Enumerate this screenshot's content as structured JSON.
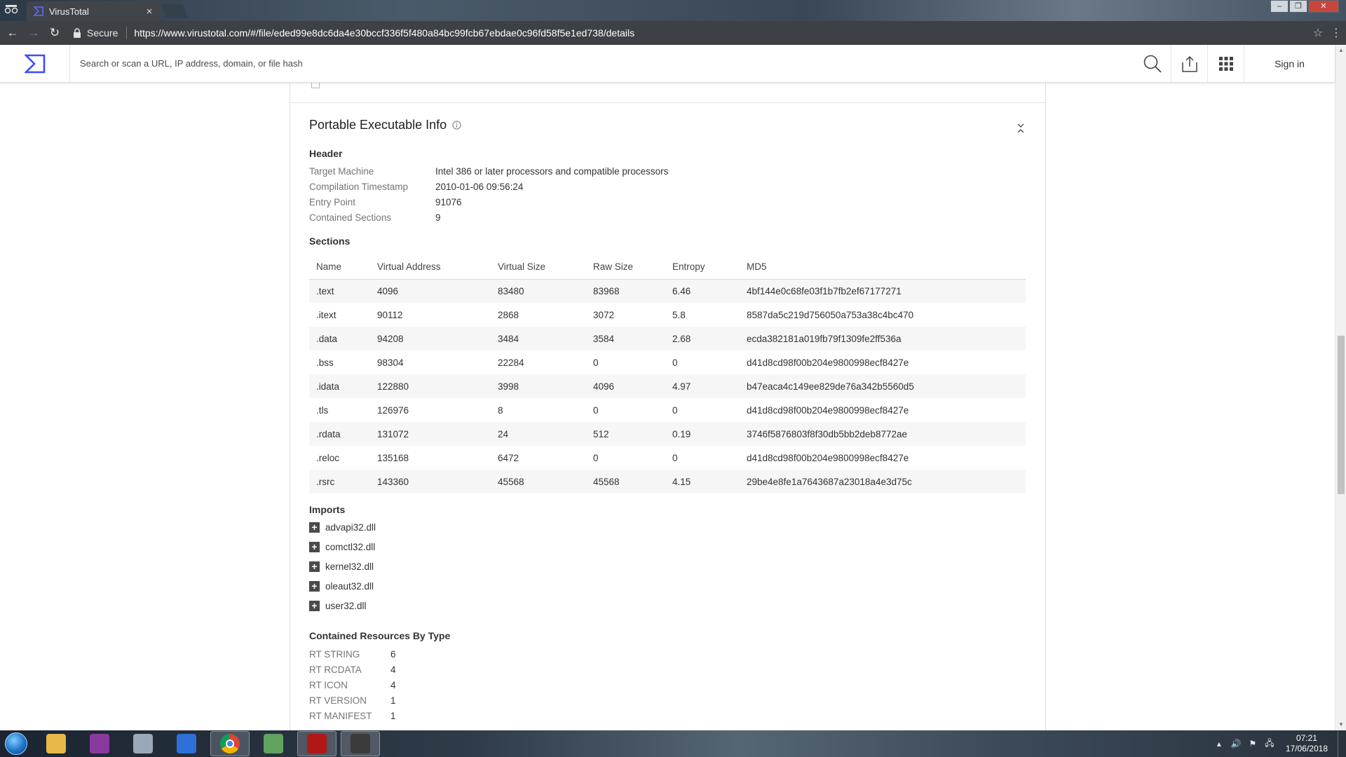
{
  "browser": {
    "tab_title": "VirusTotal",
    "secure_label": "Secure",
    "url": "https://www.virustotal.com/#/file/eded99e8dc6da4e30bccf336f5f480a84bc99fcb67ebdae0c96fd58f5e1ed738/details"
  },
  "header": {
    "search_placeholder": "Search or scan a URL, IP address, domain, or file hash",
    "signin_label": "Sign in"
  },
  "pe_info": {
    "title": "Portable Executable Info",
    "header_label": "Header",
    "fields": [
      {
        "key": "Target Machine",
        "value": "Intel 386 or later processors and compatible processors"
      },
      {
        "key": "Compilation Timestamp",
        "value": "2010-01-06 09:56:24"
      },
      {
        "key": "Entry Point",
        "value": "91076"
      },
      {
        "key": "Contained Sections",
        "value": "9"
      }
    ],
    "sections_label": "Sections",
    "sections_columns": [
      "Name",
      "Virtual Address",
      "Virtual Size",
      "Raw Size",
      "Entropy",
      "MD5"
    ],
    "sections": [
      [
        ".text",
        "4096",
        "83480",
        "83968",
        "6.46",
        "4bf144e0c68fe03f1b7fb2ef67177271"
      ],
      [
        ".itext",
        "90112",
        "2868",
        "3072",
        "5.8",
        "8587da5c219d756050a753a38c4bc470"
      ],
      [
        ".data",
        "94208",
        "3484",
        "3584",
        "2.68",
        "ecda382181a019fb79f1309fe2ff536a"
      ],
      [
        ".bss",
        "98304",
        "22284",
        "0",
        "0",
        "d41d8cd98f00b204e9800998ecf8427e"
      ],
      [
        ".idata",
        "122880",
        "3998",
        "4096",
        "4.97",
        "b47eaca4c149ee829de76a342b5560d5"
      ],
      [
        ".tls",
        "126976",
        "8",
        "0",
        "0",
        "d41d8cd98f00b204e9800998ecf8427e"
      ],
      [
        ".rdata",
        "131072",
        "24",
        "512",
        "0.19",
        "3746f5876803f8f30db5bb2deb8772ae"
      ],
      [
        ".reloc",
        "135168",
        "6472",
        "0",
        "0",
        "d41d8cd98f00b204e9800998ecf8427e"
      ],
      [
        ".rsrc",
        "143360",
        "45568",
        "45568",
        "4.15",
        "29be4e8fe1a7643687a23018a4e3d75c"
      ]
    ],
    "imports_label": "Imports",
    "imports": [
      "advapi32.dll",
      "comctl32.dll",
      "kernel32.dll",
      "oleaut32.dll",
      "user32.dll"
    ],
    "resources_label": "Contained Resources By Type",
    "resources": [
      {
        "key": "RT STRING",
        "value": "6"
      },
      {
        "key": "RT RCDATA",
        "value": "4"
      },
      {
        "key": "RT ICON",
        "value": "4"
      },
      {
        "key": "RT VERSION",
        "value": "1"
      },
      {
        "key": "RT MANIFEST",
        "value": "1"
      }
    ]
  },
  "taskbar": {
    "time": "07:21",
    "date": "17/06/2018",
    "apps": [
      {
        "icon": "file-explorer-icon",
        "color": "#e8b84a",
        "active": false
      },
      {
        "icon": "winrar-icon",
        "color": "#8a3a9e",
        "active": false
      },
      {
        "icon": "keyboard-app-icon",
        "color": "#9aa8b8",
        "active": false
      },
      {
        "icon": "malwarebytes-icon",
        "color": "#2e6fd8",
        "active": false
      },
      {
        "icon": "chrome-icon",
        "color": "#db4437",
        "active": true
      },
      {
        "icon": "task-manager-icon",
        "color": "#5fa35f",
        "active": false
      },
      {
        "icon": "gpu-tweak-icon",
        "color": "#b01818",
        "active": true
      },
      {
        "icon": "afterburner-icon",
        "color": "#3b3b3b",
        "active": true
      }
    ]
  },
  "colors": {
    "vt_blue": "#394eff",
    "text_primary": "#212121",
    "text_secondary": "#757575"
  }
}
